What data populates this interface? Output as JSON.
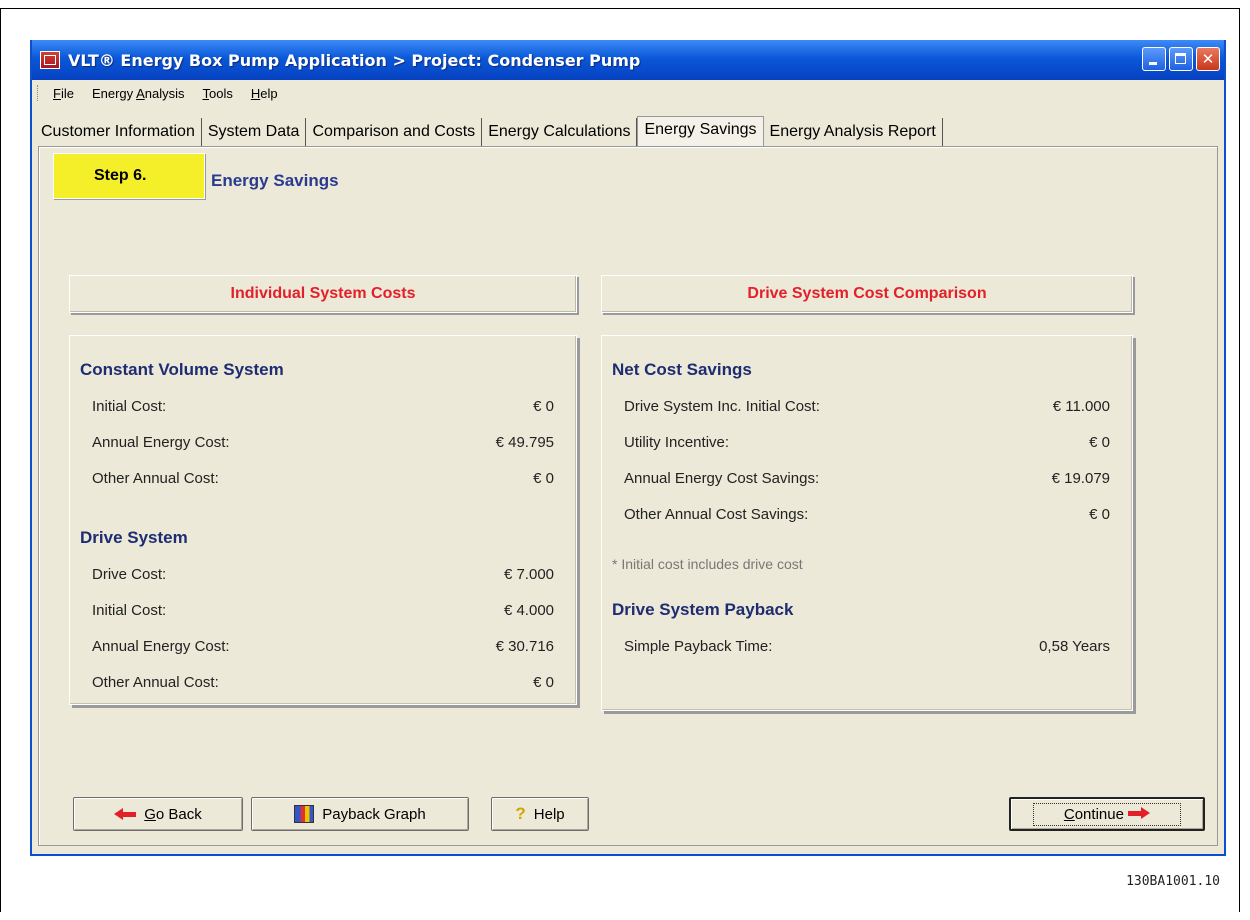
{
  "window": {
    "title": "VLT® Energy Box Pump Application > Project: Condenser Pump"
  },
  "menu": {
    "items": [
      {
        "first": "F",
        "rest": "ile"
      },
      {
        "pre": "Energy ",
        "u": "A",
        "post": "nalysis"
      },
      {
        "first": "T",
        "rest": "ools"
      },
      {
        "first": "H",
        "rest": "elp"
      }
    ]
  },
  "tabs": [
    "Customer Information",
    "System Data",
    "Comparison and Costs",
    "Energy Calculations",
    "Energy Savings",
    "Energy Analysis Report"
  ],
  "step": {
    "label": "Step 6.",
    "title": "Energy Savings"
  },
  "left": {
    "header": "Individual System Costs",
    "groups": [
      {
        "title": "Constant Volume System",
        "rows": [
          {
            "label": "Initial Cost:",
            "value": "€ 0"
          },
          {
            "label": "Annual Energy Cost:",
            "value": "€ 49.795"
          },
          {
            "label": "Other Annual Cost:",
            "value": "€ 0"
          }
        ]
      },
      {
        "title": "Drive System",
        "rows": [
          {
            "label": "Drive Cost:",
            "value": "€ 7.000"
          },
          {
            "label": "Initial Cost:",
            "value": "€ 4.000"
          },
          {
            "label": "Annual Energy Cost:",
            "value": "€ 30.716"
          },
          {
            "label": "Other Annual Cost:",
            "value": "€ 0"
          }
        ]
      }
    ]
  },
  "right": {
    "header": "Drive System Cost Comparison",
    "net_title": "Net Cost Savings",
    "net_rows": [
      {
        "label": "Drive System Inc. Initial Cost:",
        "value": "€ 11.000"
      },
      {
        "label": "Utility Incentive:",
        "value": "€ 0"
      },
      {
        "label": "Annual Energy Cost Savings:",
        "value": "€ 19.079"
      },
      {
        "label": "Other Annual Cost Savings:",
        "value": "€ 0"
      }
    ],
    "note": "* Initial cost includes drive cost",
    "payback_title": "Drive System Payback",
    "payback_rows": [
      {
        "label": "Simple Payback Time:",
        "value": "0,58 Years"
      }
    ]
  },
  "buttons": {
    "go_back": {
      "u": "G",
      "rest": "o Back"
    },
    "payback_graph": "Payback Graph",
    "help": "Help",
    "continue": {
      "u": "C",
      "rest": "ontinue"
    }
  },
  "doc_id": "130BA1001.10",
  "colors": {
    "accent_red": "#e3202a",
    "navy": "#1e2c72",
    "step_yellow": "#f5ef2a",
    "titlebar_blue": "#0a58d8"
  }
}
